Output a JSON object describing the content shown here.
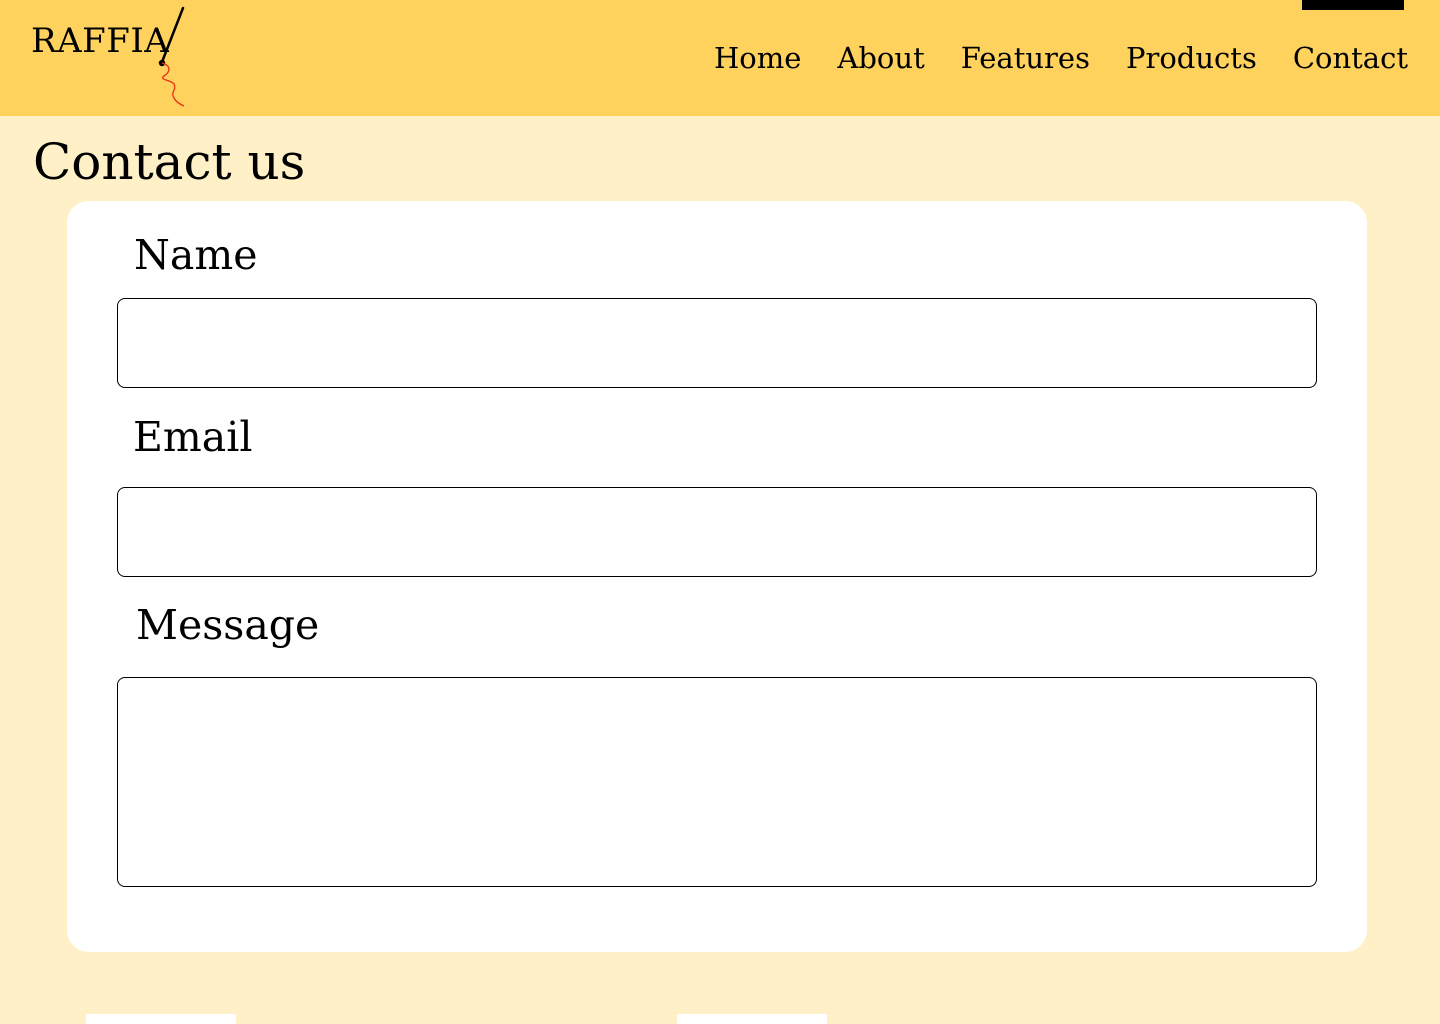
{
  "header": {
    "logo_text": "RAFFIA",
    "logo_icon": "needle-thread-icon",
    "thread_color": "#E8391A",
    "background_color": "#FFD25E"
  },
  "nav": {
    "items": [
      {
        "label": "Home"
      },
      {
        "label": "About"
      },
      {
        "label": "Features"
      },
      {
        "label": "Products"
      },
      {
        "label": "Contact"
      }
    ]
  },
  "page": {
    "title": "Contact us",
    "background_color": "#FFF0C7"
  },
  "form": {
    "name_label": "Name",
    "name_value": "",
    "email_label": "Email",
    "email_value": "",
    "message_label": "Message",
    "message_value": ""
  }
}
